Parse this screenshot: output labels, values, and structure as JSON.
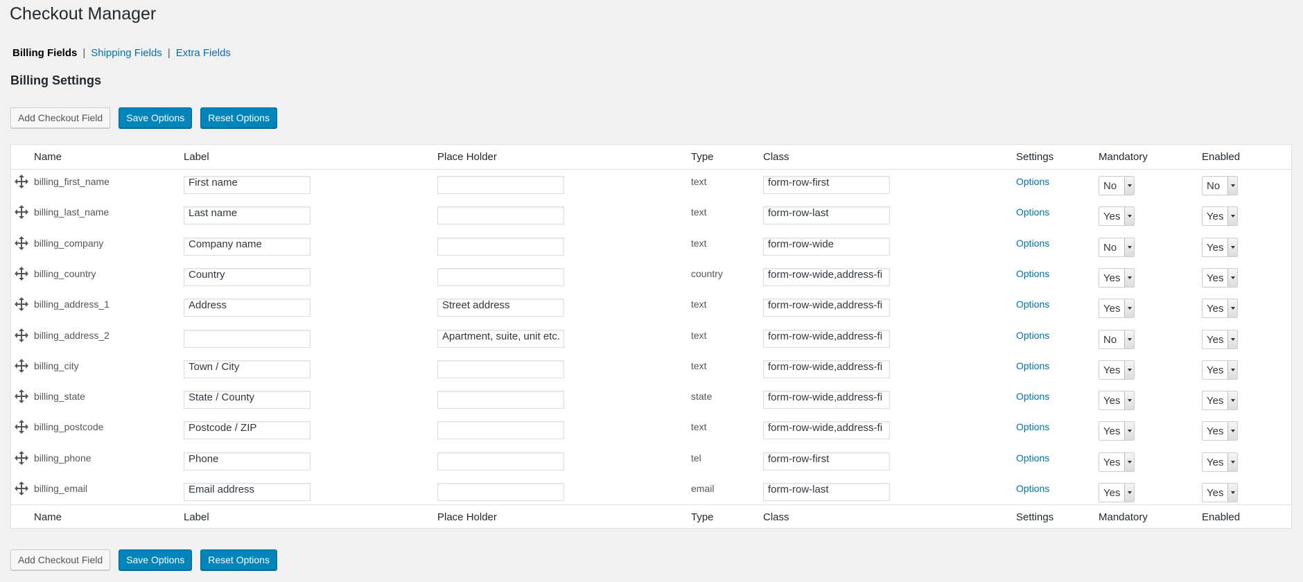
{
  "page": {
    "title": "Checkout Manager",
    "section_title": "Billing Settings"
  },
  "subnav": {
    "current": "Billing Fields",
    "links": [
      "Shipping Fields",
      "Extra Fields"
    ],
    "separator": "|"
  },
  "buttons": {
    "add": "Add Checkout Field",
    "save": "Save Options",
    "reset": "Reset Options"
  },
  "columns": {
    "name": "Name",
    "label": "Label",
    "placeholder": "Place Holder",
    "type": "Type",
    "class": "Class",
    "settings": "Settings",
    "mandatory": "Mandatory",
    "enabled": "Enabled"
  },
  "rows": [
    {
      "name": "billing_first_name",
      "label": "First name",
      "placeholder": "",
      "type": "text",
      "class": "form-row-first",
      "settings": "Options",
      "mandatory": "No",
      "enabled": "No"
    },
    {
      "name": "billing_last_name",
      "label": "Last name",
      "placeholder": "",
      "type": "text",
      "class": "form-row-last",
      "settings": "Options",
      "mandatory": "Yes",
      "enabled": "Yes"
    },
    {
      "name": "billing_company",
      "label": "Company name",
      "placeholder": "",
      "type": "text",
      "class": "form-row-wide",
      "settings": "Options",
      "mandatory": "No",
      "enabled": "Yes"
    },
    {
      "name": "billing_country",
      "label": "Country",
      "placeholder": "",
      "type": "country",
      "class": "form-row-wide,address-fi",
      "settings": "Options",
      "mandatory": "Yes",
      "enabled": "Yes"
    },
    {
      "name": "billing_address_1",
      "label": "Address",
      "placeholder": "Street address",
      "type": "text",
      "class": "form-row-wide,address-fi",
      "settings": "Options",
      "mandatory": "Yes",
      "enabled": "Yes"
    },
    {
      "name": "billing_address_2",
      "label": "",
      "placeholder": "Apartment, suite, unit etc.",
      "type": "text",
      "class": "form-row-wide,address-fi",
      "settings": "Options",
      "mandatory": "No",
      "enabled": "Yes"
    },
    {
      "name": "billing_city",
      "label": "Town / City",
      "placeholder": "",
      "type": "text",
      "class": "form-row-wide,address-fi",
      "settings": "Options",
      "mandatory": "Yes",
      "enabled": "Yes"
    },
    {
      "name": "billing_state",
      "label": "State / County",
      "placeholder": "",
      "type": "state",
      "class": "form-row-wide,address-fi",
      "settings": "Options",
      "mandatory": "Yes",
      "enabled": "Yes"
    },
    {
      "name": "billing_postcode",
      "label": "Postcode / ZIP",
      "placeholder": "",
      "type": "text",
      "class": "form-row-wide,address-fi",
      "settings": "Options",
      "mandatory": "Yes",
      "enabled": "Yes"
    },
    {
      "name": "billing_phone",
      "label": "Phone",
      "placeholder": "",
      "type": "tel",
      "class": "form-row-first",
      "settings": "Options",
      "mandatory": "Yes",
      "enabled": "Yes"
    },
    {
      "name": "billing_email",
      "label": "Email address",
      "placeholder": "",
      "type": "email",
      "class": "form-row-last",
      "settings": "Options",
      "mandatory": "Yes",
      "enabled": "Yes"
    }
  ],
  "icons": {
    "drag": "move-arrows-icon",
    "select_arrow": "chevron-down-icon"
  },
  "colors": {
    "link": "#0073aa",
    "primary_button": "#0085ba",
    "background": "#f1f1f1"
  }
}
